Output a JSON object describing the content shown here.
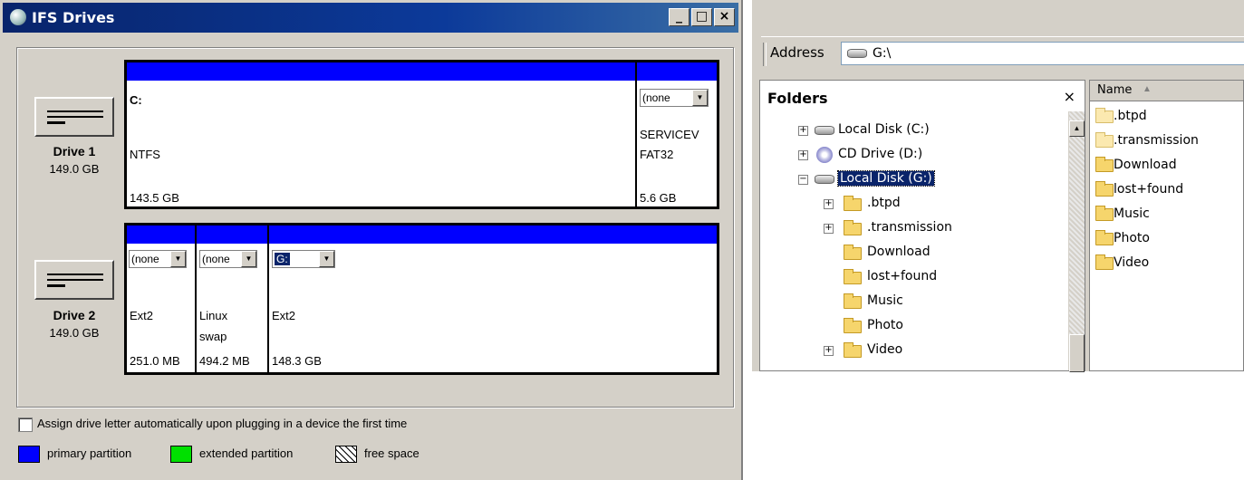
{
  "ifs": {
    "title": "IFS Drives",
    "title_buttons": {
      "minimize": "_",
      "maximize": "□",
      "close": "×"
    },
    "drives": [
      {
        "name": "Drive 1",
        "size": "149.0 GB",
        "partitions": [
          {
            "letter": "C:",
            "letter_is_dropdown": false,
            "fs": "NTFS",
            "size": "143.5 GB"
          },
          {
            "letter": "(none",
            "letter_is_dropdown": true,
            "label": "SERVICEV",
            "fs": "FAT32",
            "size": "5.6 GB"
          }
        ]
      },
      {
        "name": "Drive 2",
        "size": "149.0 GB",
        "partitions": [
          {
            "letter": "(none",
            "letter_is_dropdown": true,
            "fs": "Ext2",
            "size": "251.0 MB"
          },
          {
            "letter": "(none",
            "letter_is_dropdown": true,
            "fs": "Linux",
            "fs2": "swap",
            "size": "494.2 MB"
          },
          {
            "letter": "G:",
            "letter_is_dropdown": true,
            "selected": true,
            "fs": "Ext2",
            "size": "148.3 GB"
          }
        ]
      }
    ],
    "auto_assign": {
      "label": "Assign drive letter automatically upon plugging in a device the first time",
      "checked": false
    },
    "legend": {
      "primary": "primary partition",
      "extended": "extended partition",
      "free": "free space"
    },
    "colors": {
      "primary": "#0000ff",
      "extended": "#00e000",
      "titlebar": "#0a246a"
    }
  },
  "explorer": {
    "address_label": "Address",
    "address_value": "G:\\",
    "folders_pane": {
      "title": "Folders",
      "close": "×",
      "items": [
        {
          "label": "Local Disk (C:)",
          "expander": "+",
          "icon": "hard-drive-icon",
          "level": 0
        },
        {
          "label": "CD Drive (D:)",
          "expander": "+",
          "icon": "cd-drive-icon",
          "level": 0
        },
        {
          "label": "Local Disk (G:)",
          "expander": "−",
          "icon": "hard-drive-icon",
          "level": 0,
          "selected": true
        },
        {
          "label": ".btpd",
          "expander": "+",
          "icon": "folder-icon",
          "level": 1
        },
        {
          "label": ".transmission",
          "expander": "+",
          "icon": "folder-icon",
          "level": 1
        },
        {
          "label": "Download",
          "expander": "",
          "icon": "folder-icon",
          "level": 1
        },
        {
          "label": "lost+found",
          "expander": "",
          "icon": "folder-icon",
          "level": 1
        },
        {
          "label": "Music",
          "expander": "",
          "icon": "folder-icon",
          "level": 1
        },
        {
          "label": "Photo",
          "expander": "",
          "icon": "folder-icon",
          "level": 1
        },
        {
          "label": "Video",
          "expander": "+",
          "icon": "folder-icon",
          "level": 1
        }
      ]
    },
    "list_pane": {
      "column_name": "Name",
      "sort_indicator": "▲",
      "items": [
        ".btpd",
        ".transmission",
        "Download",
        "lost+found",
        "Music",
        "Photo",
        "Video"
      ]
    }
  }
}
